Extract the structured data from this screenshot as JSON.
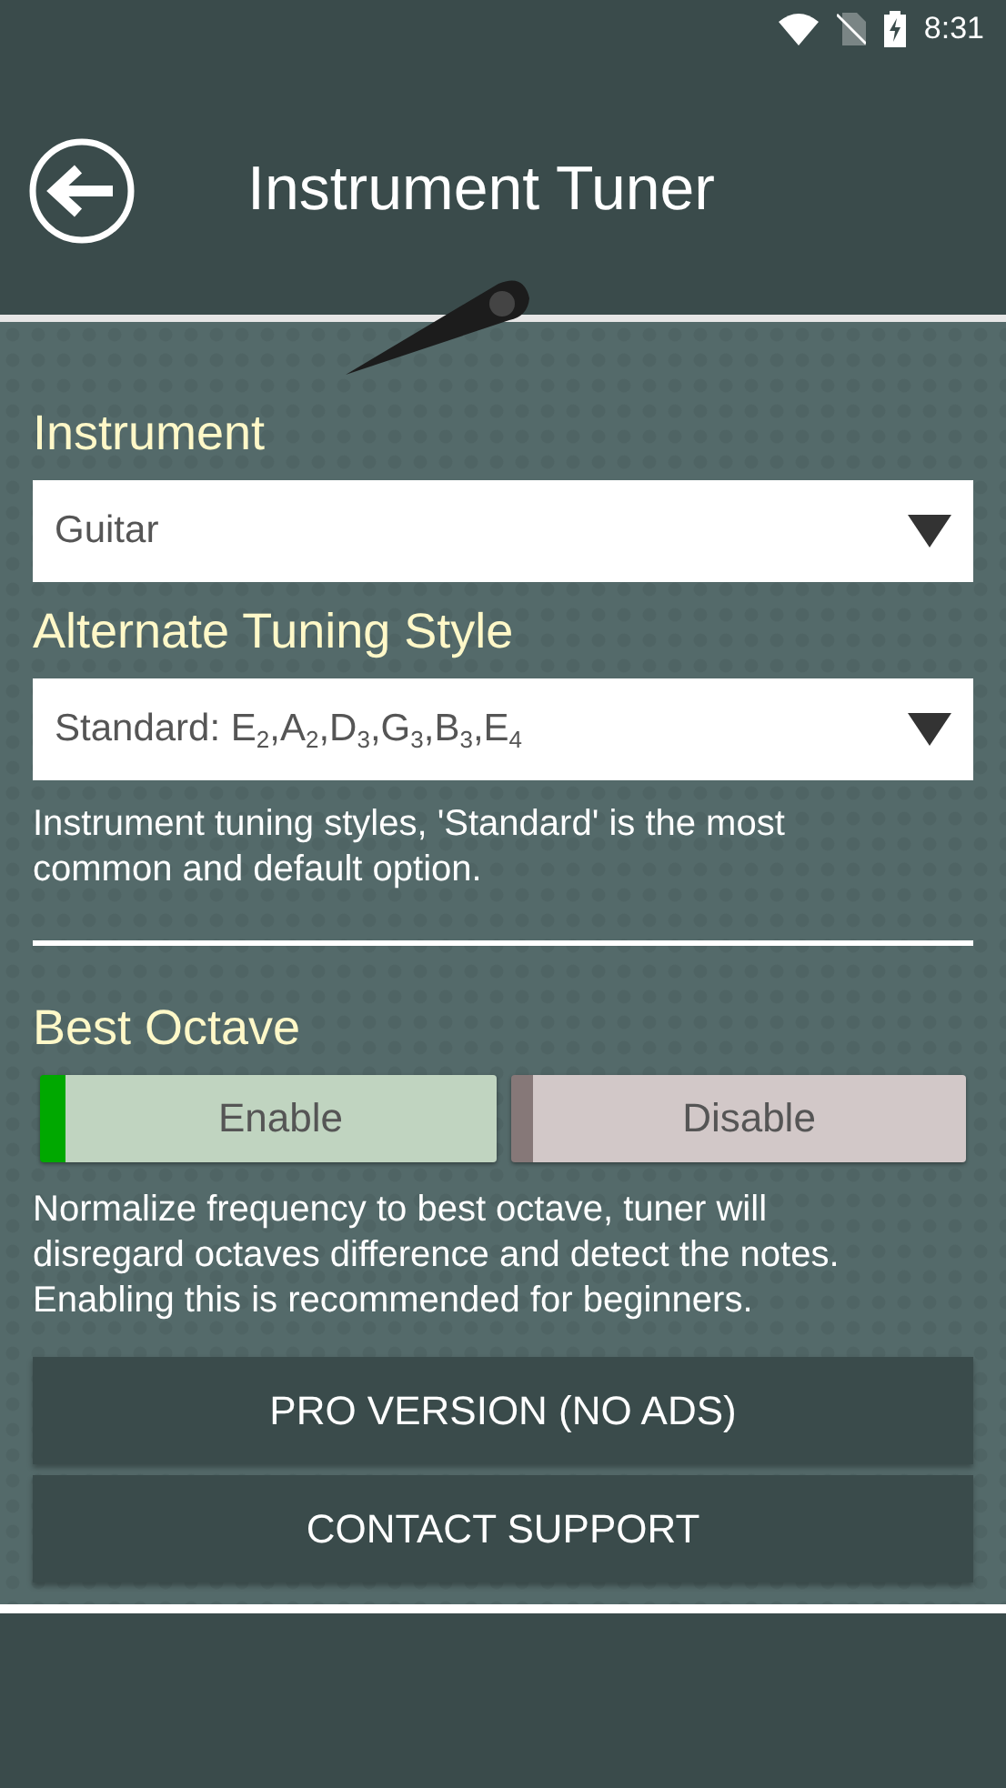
{
  "status_bar": {
    "time": "8:31"
  },
  "app_bar": {
    "title": "Instrument Tuner"
  },
  "instrument": {
    "label": "Instrument",
    "value": "Guitar"
  },
  "tuning": {
    "label": "Alternate Tuning Style",
    "value": "Standard: E$_{2}$,A$_{2}$,D$_{3}$,G$_{3}$,B$_{3}$,E$_{4}$",
    "help": "Instrument tuning styles, 'Standard' is the most common and default option."
  },
  "best_octave": {
    "label": "Best Octave",
    "options": [
      {
        "label": "Enable",
        "selected": true
      },
      {
        "label": "Disable",
        "selected": false
      }
    ],
    "help": "Normalize frequency to best octave, tuner will disregard octaves difference and detect the notes. Enabling this is recommended for beginners."
  },
  "buttons": [
    "PRO VERSION (NO ADS)",
    "CONTACT SUPPORT"
  ]
}
